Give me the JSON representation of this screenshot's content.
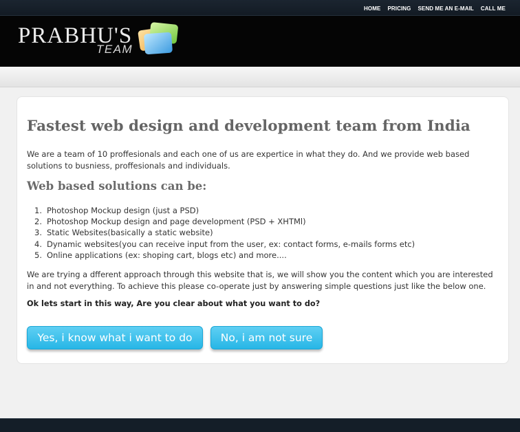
{
  "nav": {
    "items": [
      "HOME",
      "PRICING",
      "SEND ME AN E-MAIL",
      "CALL ME"
    ]
  },
  "logo": {
    "main": "PRABHU'S",
    "sub": "TEAM"
  },
  "content": {
    "title": "Fastest web design and development team from India",
    "intro": "We are a team of 10 proffesionals and each one of us are expertice in what they do. And we provide web based solutions to busniess, proffesionals and individuals.",
    "subtitle": "Web based solutions can be:",
    "solutions": [
      "Photoshop Mockup design (just a PSD)",
      "Photoshop Mockup design and page development (PSD + XHTMl)",
      "Static Websites(basically a static website)",
      "Dynamic websites(you can receive input from the user, ex: contact forms, e-mails forms etc)",
      "Online applications (ex: shoping cart, blogs etc) and more...."
    ],
    "approach": "We are trying a dfferent approach through this website that is, we will show you the content which you are interested in and not everything. To achieve this please co-operate just by answering simple questions just like the below one.",
    "question": "Ok lets start in this way, Are you clear about what you want to do?",
    "yes_button": "Yes, i know what i want to do",
    "no_button": "No, i am not sure"
  },
  "colors": {
    "button": "#27b6e6",
    "header": "#050505",
    "nav": "#131b24"
  }
}
